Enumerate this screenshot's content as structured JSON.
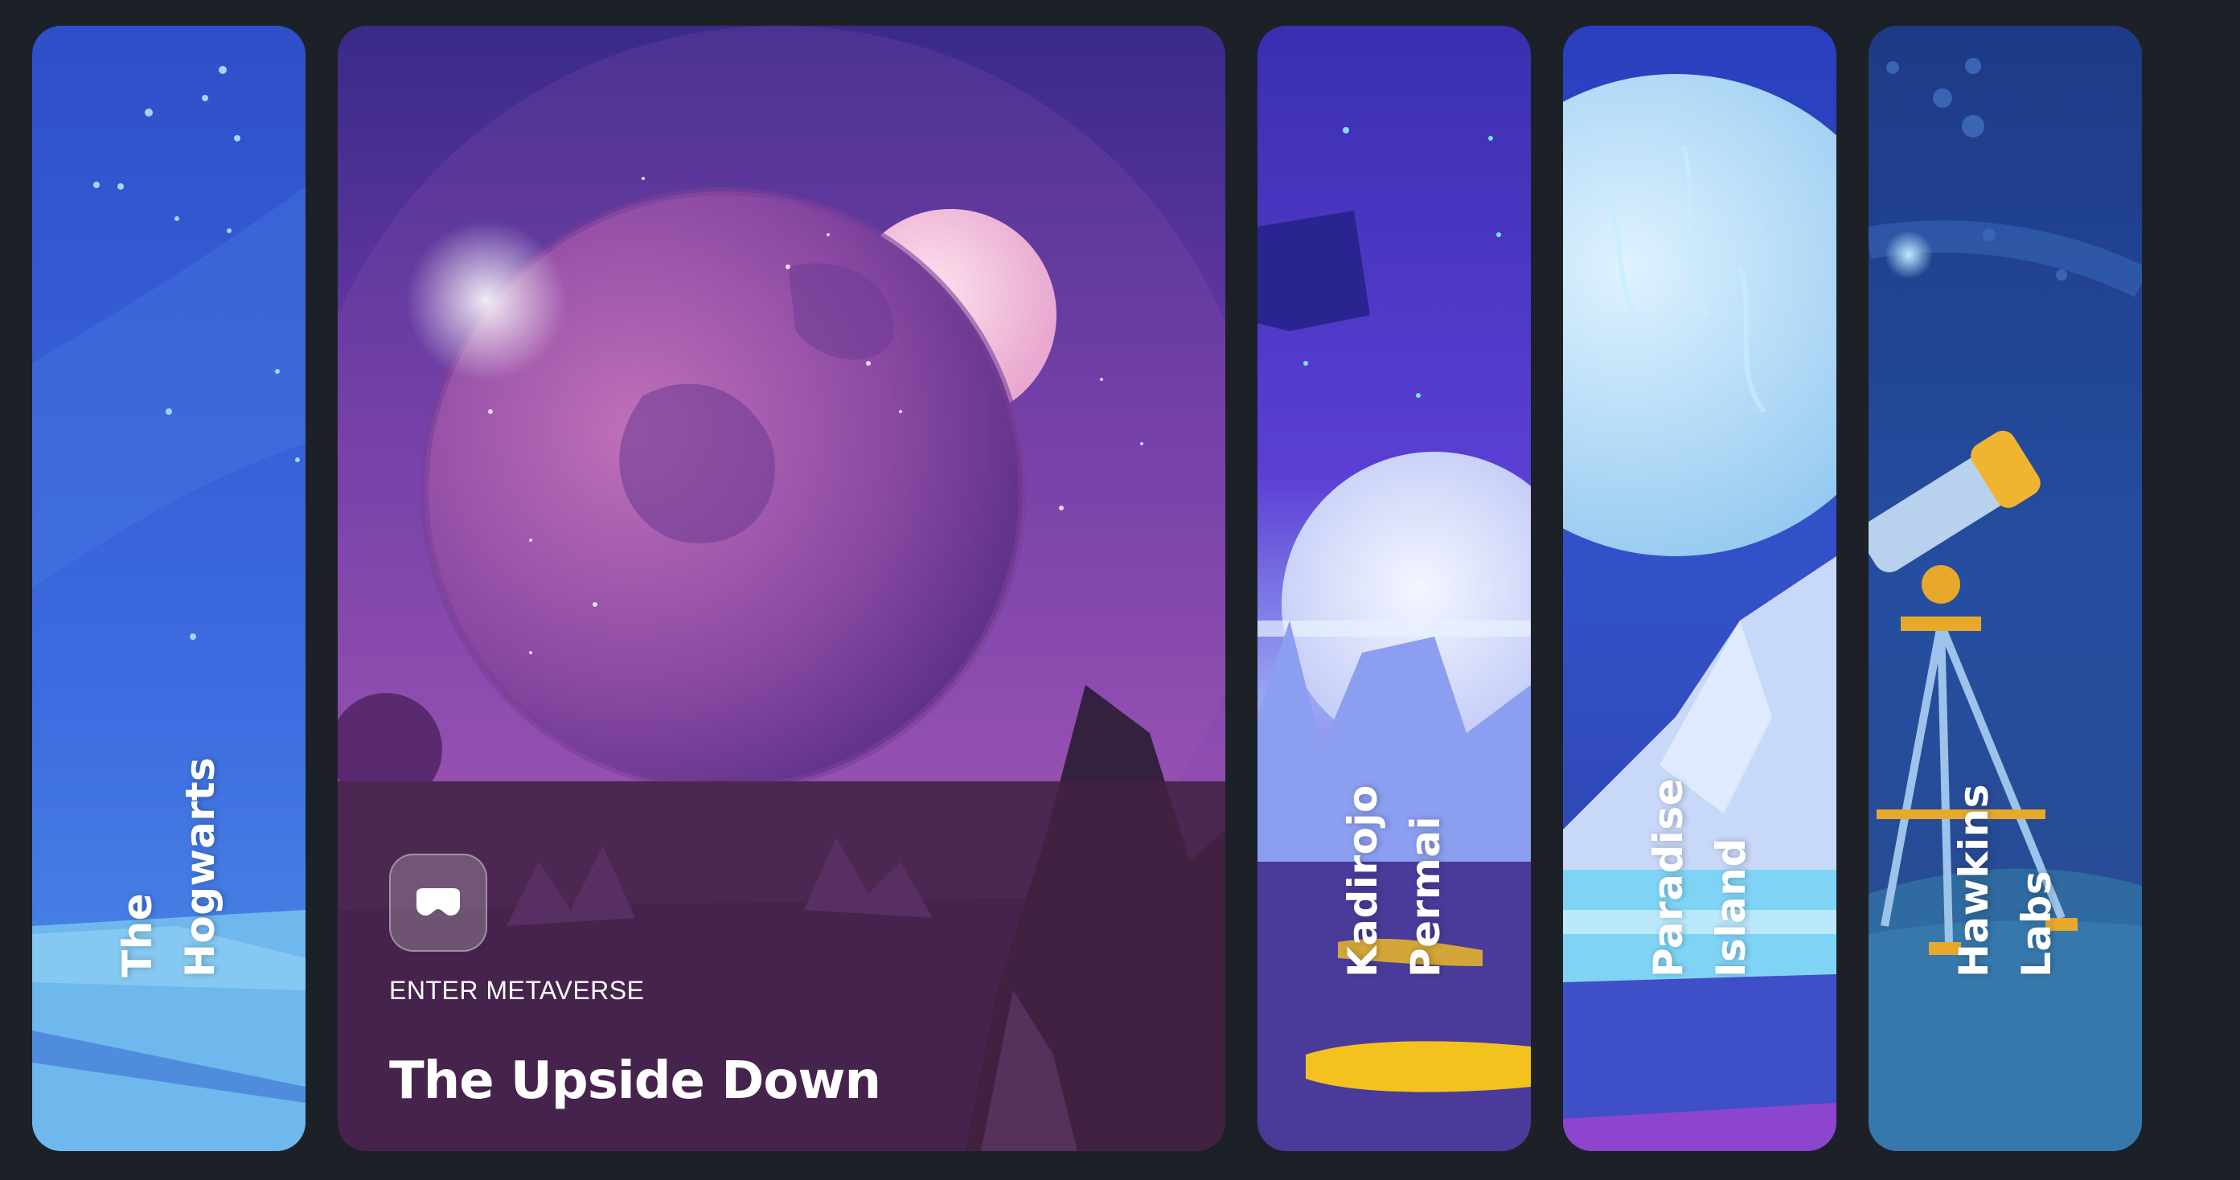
{
  "cards": [
    {
      "id": "hogwarts",
      "lines": [
        "The",
        "Hogwarts"
      ],
      "expanded": false
    },
    {
      "id": "upside-down",
      "eyebrow": "ENTER METAVERSE",
      "title": "The Upside Down",
      "expanded": true,
      "button_icon": "vr-headset-icon"
    },
    {
      "id": "kadirojo",
      "lines": [
        "Kadirojo",
        "Permai"
      ],
      "expanded": false
    },
    {
      "id": "paradise",
      "lines": [
        "Paradise",
        "Island"
      ],
      "expanded": false
    },
    {
      "id": "hawkins",
      "lines": [
        "Hawkins",
        "Labs"
      ],
      "expanded": false
    }
  ],
  "colors": {
    "page_background": "#1c2128",
    "hogwarts": "#3a67d8",
    "upside_down": "#6a3a9e",
    "kadirojo": "#4a3fc0",
    "paradise": "#2c4fc4",
    "hawkins": "#1d3f86"
  }
}
